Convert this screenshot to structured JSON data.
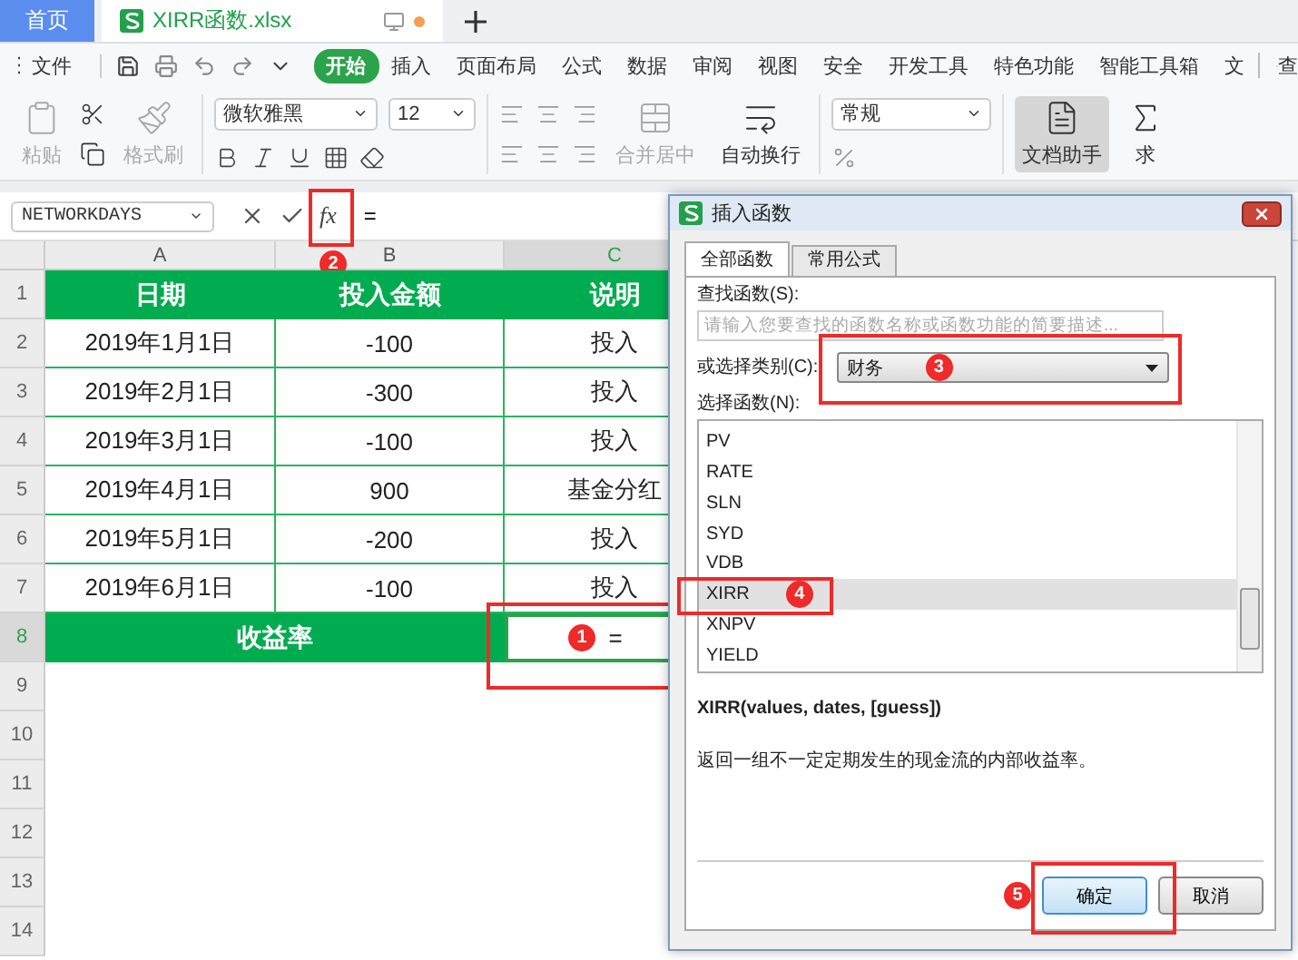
{
  "tabs": [
    {
      "label": "首页",
      "kind": "home",
      "selected": false
    },
    {
      "label": "XIRR函数.xlsx",
      "kind": "file",
      "selected": true,
      "unsaved": true
    }
  ],
  "menu": {
    "file": "文件",
    "items": [
      {
        "label": "开始",
        "selected": true
      },
      {
        "label": "插入",
        "selected": false
      },
      {
        "label": "页面布局",
        "selected": false
      },
      {
        "label": "公式",
        "selected": false
      },
      {
        "label": "数据",
        "selected": false
      },
      {
        "label": "审阅",
        "selected": false
      },
      {
        "label": "视图",
        "selected": false
      },
      {
        "label": "安全",
        "selected": false
      },
      {
        "label": "开发工具",
        "selected": false
      },
      {
        "label": "特色功能",
        "selected": false
      },
      {
        "label": "智能工具箱",
        "selected": false
      },
      {
        "label": "文",
        "selected": false
      }
    ],
    "search": "查"
  },
  "ribbon": {
    "paste": {
      "label": "粘贴",
      "disabled": true
    },
    "format_painter": {
      "label": "格式刷",
      "disabled": true
    },
    "font": "微软雅黑",
    "font_size": "12",
    "merge": {
      "label": "合并居中",
      "disabled": true
    },
    "wrap": {
      "label": "自动换行",
      "disabled": false
    },
    "number_format": "常规",
    "assistant": {
      "label": "文档助手",
      "selected": true
    },
    "sum": {
      "label": "求",
      "disabled": false
    }
  },
  "formula_bar": {
    "name_box": "NETWORKDAYS",
    "fx": "fx",
    "value": "="
  },
  "table": {
    "columns": [
      {
        "label": "A",
        "selected": false
      },
      {
        "label": "B",
        "selected": false
      },
      {
        "label": "C",
        "selected": true
      }
    ],
    "rows": [
      {
        "number": "1",
        "kind": "header",
        "selected": false,
        "cells": [
          "日期",
          "投入金额",
          "说明"
        ]
      },
      {
        "number": "2",
        "kind": "data",
        "selected": false,
        "cells": [
          "2019年1月1日",
          "-100",
          "投入"
        ]
      },
      {
        "number": "3",
        "kind": "data",
        "selected": false,
        "cells": [
          "2019年2月1日",
          "-300",
          "投入"
        ]
      },
      {
        "number": "4",
        "kind": "data",
        "selected": false,
        "cells": [
          "2019年3月1日",
          "-100",
          "投入"
        ]
      },
      {
        "number": "5",
        "kind": "data",
        "selected": false,
        "cells": [
          "2019年4月1日",
          "900",
          "基金分红"
        ]
      },
      {
        "number": "6",
        "kind": "data",
        "selected": false,
        "cells": [
          "2019年5月1日",
          "-200",
          "投入"
        ]
      },
      {
        "number": "7",
        "kind": "data",
        "selected": false,
        "cells": [
          "2019年6月1日",
          "-100",
          "投入"
        ]
      },
      {
        "number": "8",
        "kind": "total",
        "selected": true,
        "cells": [
          "收益率",
          "",
          "="
        ]
      },
      {
        "number": "9",
        "kind": "empty",
        "selected": false,
        "cells": []
      },
      {
        "number": "10",
        "kind": "empty",
        "selected": false,
        "cells": []
      },
      {
        "number": "11",
        "kind": "empty",
        "selected": false,
        "cells": []
      },
      {
        "number": "12",
        "kind": "empty",
        "selected": false,
        "cells": []
      },
      {
        "number": "13",
        "kind": "empty",
        "selected": false,
        "cells": []
      },
      {
        "number": "14",
        "kind": "empty",
        "selected": false,
        "cells": []
      }
    ]
  },
  "dialog": {
    "title": "插入函数",
    "tabs": [
      {
        "label": "全部函数",
        "selected": true
      },
      {
        "label": "常用公式",
        "selected": false
      }
    ],
    "search_label": "查找函数(S):",
    "search_placeholder": "请输入您要查找的函数名称或函数功能的简要描述...",
    "category_label": "或选择类别(C):",
    "category": "财务",
    "list_label": "选择函数(N):",
    "functions": [
      {
        "label": "PV",
        "selected": false
      },
      {
        "label": "RATE",
        "selected": false
      },
      {
        "label": "SLN",
        "selected": false
      },
      {
        "label": "SYD",
        "selected": false
      },
      {
        "label": "VDB",
        "selected": false
      },
      {
        "label": "XIRR",
        "selected": true
      },
      {
        "label": "XNPV",
        "selected": false
      },
      {
        "label": "YIELD",
        "selected": false
      }
    ],
    "signature": "XIRR(values, dates, [guess])",
    "description": "返回一组不一定定期发生的现金流的内部收益率。",
    "buttons": [
      {
        "label": "确定",
        "kind": "primary"
      },
      {
        "label": "取消",
        "kind": "secondary"
      }
    ]
  },
  "annotations": [
    "1",
    "2",
    "3",
    "4",
    "5"
  ]
}
